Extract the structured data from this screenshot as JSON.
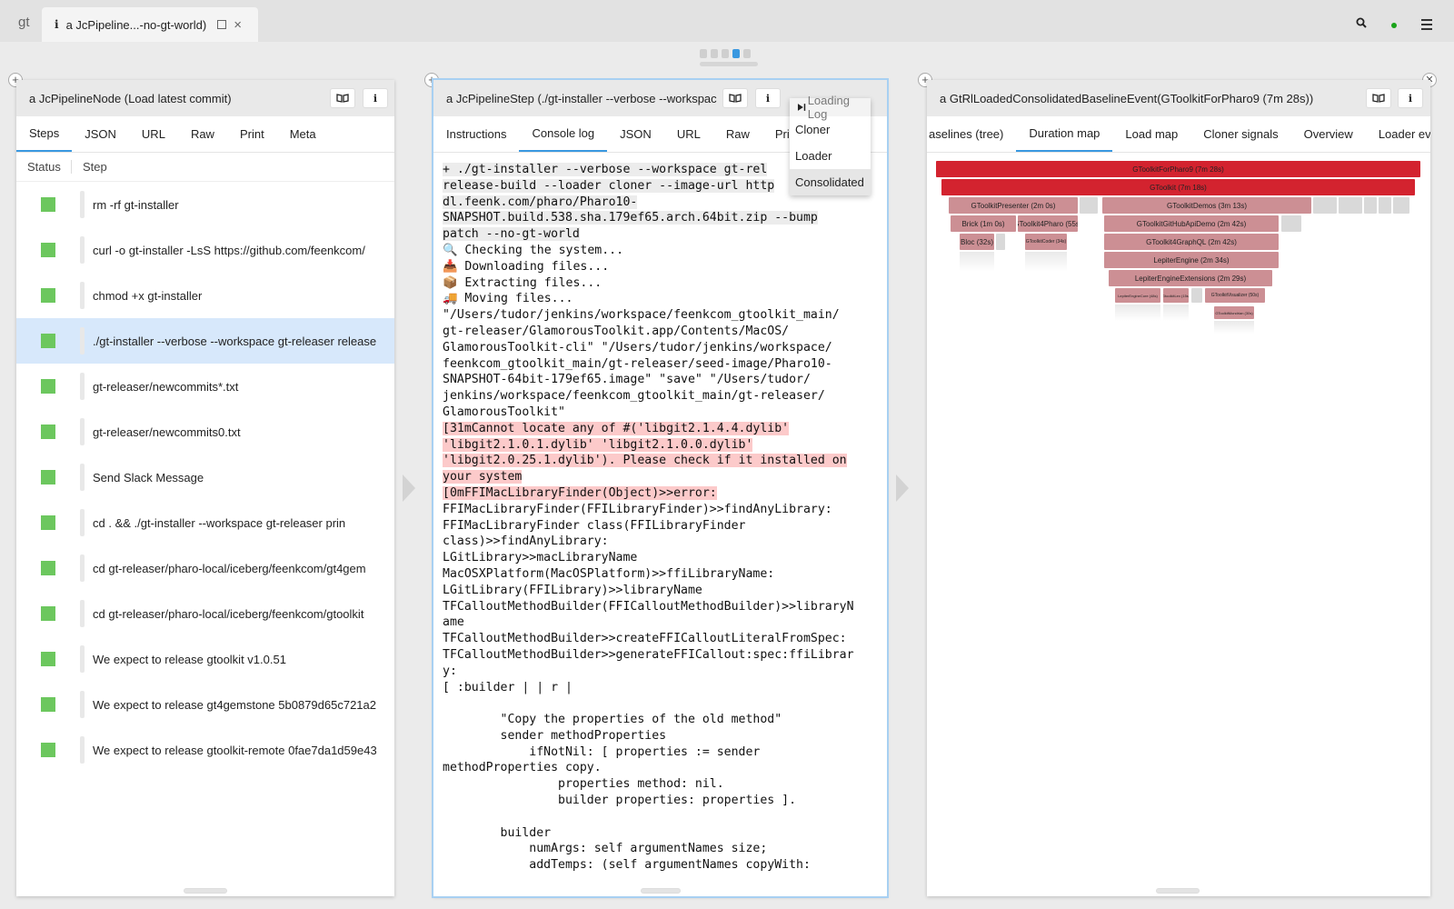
{
  "app": {
    "logo": "gt"
  },
  "window_tab": {
    "info_glyph": "i",
    "label": "a JcPipeline...-no-gt-world)",
    "close": "×"
  },
  "colors": {
    "accent": "#3a98e0",
    "status_ok": "#6cc75e",
    "flame_root": "#d3232f",
    "flame_child": "#cc8f94",
    "error_highlight": "#fccaca"
  },
  "left_pane": {
    "title": "a JcPipelineNode (Load latest commit)",
    "tabs": [
      "Steps",
      "JSON",
      "URL",
      "Raw",
      "Print",
      "Meta"
    ],
    "columns": {
      "status": "Status",
      "step": "Step"
    },
    "rows": [
      "rm -rf gt-installer",
      "curl -o gt-installer -LsS https://github.com/feenkcom/",
      "chmod +x gt-installer",
      "./gt-installer --verbose --workspace gt-releaser release",
      "gt-releaser/newcommits*.txt",
      "gt-releaser/newcommits0.txt",
      "Send Slack Message",
      "cd . &&           ./gt-installer --workspace gt-releaser prin",
      "cd gt-releaser/pharo-local/iceberg/feenkcom/gt4gem",
      "cd gt-releaser/pharo-local/iceberg/feenkcom/gtoolkit",
      "We expect to release gtoolkit v1.0.51",
      "We expect to release gt4gemstone 5b0879d65c721a2",
      "We expect to release gtoolkit-remote 0fae7da1d59e43"
    ]
  },
  "middle_pane": {
    "title": "a JcPipelineStep (./gt-installer --verbose --workspac",
    "tabs": [
      "Instructions",
      "Console log",
      "JSON",
      "URL",
      "Raw",
      "Prir"
    ],
    "dropdown": {
      "header": "Loading Log",
      "items": [
        "Cloner",
        "Loader",
        "Consolidated"
      ]
    },
    "console": [
      "+ ./gt-installer --verbose --workspace gt-rel",
      "release-build --loader cloner --image-url http",
      "dl.feenk.com/pharo/Pharo10-",
      "SNAPSHOT.build.538.sha.179ef65.arch.64bit.zip --bump",
      "patch --no-gt-world",
      "🔍 Checking the system...",
      "📥 Downloading files...",
      "📦 Extracting files...",
      "🚚 Moving files...",
      "\"/Users/tudor/jenkins/workspace/feenkcom_gtoolkit_main/",
      "gt-releaser/GlamorousToolkit.app/Contents/MacOS/",
      "GlamorousToolkit-cli\" \"/Users/tudor/jenkins/workspace/",
      "feenkcom_gtoolkit_main/gt-releaser/seed-image/Pharo10-",
      "SNAPSHOT-64bit-179ef65.image\" \"save\" \"/Users/tudor/",
      "jenkins/workspace/feenkcom_gtoolkit_main/gt-releaser/",
      "GlamorousToolkit\"",
      "[31mCannot locate any of #('libgit2.1.4.4.dylib'",
      "'libgit2.1.0.1.dylib' 'libgit2.1.0.0.dylib'",
      "'libgit2.0.25.1.dylib'). Please check if it installed on",
      "your system",
      "[0mFFIMacLibraryFinder(Object)>>error:",
      "FFIMacLibraryFinder(FFILibraryFinder)>>findAnyLibrary:",
      "FFIMacLibraryFinder class(FFILibraryFinder",
      "class)>>findAnyLibrary:",
      "LGitLibrary>>macLibraryName",
      "MacOSXPlatform(MacOSPlatform)>>ffiLibraryName:",
      "LGitLibrary(FFILibrary)>>libraryName",
      "TFCalloutMethodBuilder(FFICalloutMethodBuilder)>>libraryN",
      "ame",
      "TFCalloutMethodBuilder>>createFFICalloutLiteralFromSpec:",
      "TFCalloutMethodBuilder>>generateFFICallout:spec:ffiLibrar",
      "y:",
      "[ :builder | | r |",
      "",
      "        \"Copy the properties of the old method\"",
      "        sender methodProperties",
      "            ifNotNil: [ properties := sender",
      "methodProperties copy.",
      "                properties method: nil.",
      "                builder properties: properties ].",
      "",
      "        builder",
      "            numArgs: self argumentNames size;",
      "            addTemps: (self argumentNames copyWith:"
    ]
  },
  "right_pane": {
    "title": "a GtRlLoadedConsolidatedBaselineEvent(GToolkitForPharo9 (7m 28s))",
    "tabs": [
      "aselines (tree)",
      "Duration map",
      "Load map",
      "Cloner signals",
      "Overview",
      "Loader ev"
    ],
    "flame": {
      "root": "GToolkitForPharo9 (7m 28s)",
      "level1": "GToolkit (7m 18s)",
      "presenter": "GToolkitPresenter (2m 0s)",
      "demos": "GToolkitDemos (3m 13s)",
      "brick": "Brick (1m 0s)",
      "gt4pharo": "GToolkit4Pharo (55s)",
      "github": "GToolkitGitHubApiDemo (2m 42s)",
      "bloc": "Bloc (32s)",
      "coder": "GToolkitCoder (34s)",
      "graphql": "GToolkit4GraphQL (2m 42s)",
      "lepiter": "LepiterEngine (2m 34s)",
      "lepiter_ext": "LepiterEngineExtensions (2m 29s)",
      "small1": "LepiterEngineCore (48s)",
      "small2": "GtoolkitLex (15s)",
      "visualizer": "GToolkitVisualizer (50s)",
      "mondrian": "GToolkitMondrian (30s)"
    }
  }
}
